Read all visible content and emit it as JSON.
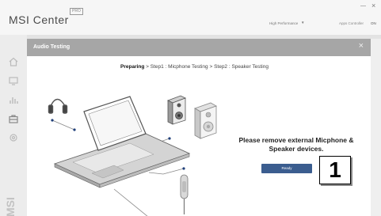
{
  "app": {
    "title": "MSI Center",
    "badge": "PRO",
    "mode_label": "High Performance",
    "mode_caret": "▼",
    "switch_label": "Apps Controller",
    "switch_state": "ON",
    "minimize": "—",
    "close": "×"
  },
  "sidebar": {
    "icons": [
      "home-icon",
      "monitor-icon",
      "chart-icon",
      "briefcase-icon",
      "settings-icon"
    ],
    "logo": "MSI"
  },
  "modal": {
    "title": "Audio Testing",
    "close": "×",
    "steps": {
      "current": "Preparing",
      "sep": " > ",
      "step1": "Step1 : Micphone Testing",
      "step2": "Step2 : Speaker Testing"
    },
    "message": "Please remove external Micphone & Speaker devices.",
    "ready_button": "Ready"
  },
  "annotation": {
    "number": "1"
  }
}
